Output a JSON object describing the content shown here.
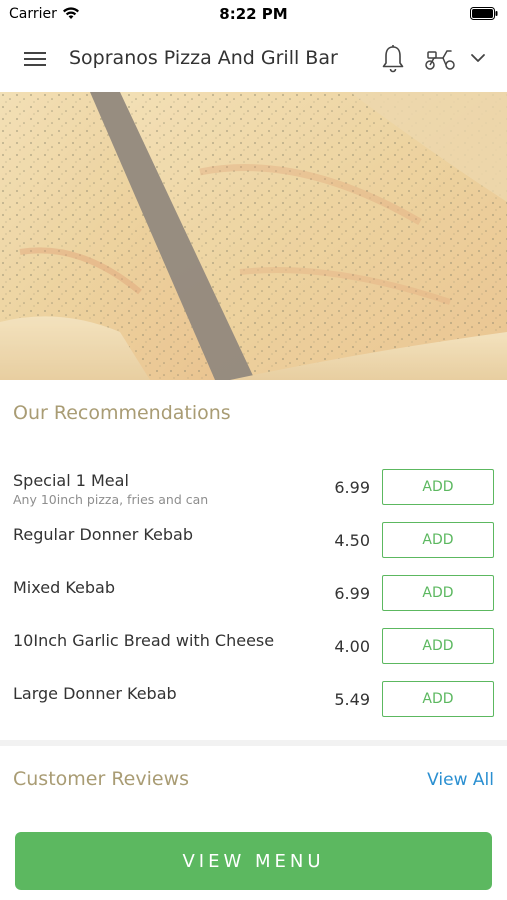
{
  "status_bar": {
    "carrier": "Carrier",
    "time": "8:22 PM"
  },
  "nav": {
    "title": "Sopranos Pizza And Grill Bar",
    "icons": [
      "menu-icon",
      "bell-icon",
      "scooter-icon",
      "chevron-down-icon"
    ]
  },
  "hero": {
    "image": "pizza-slices-photo"
  },
  "recommendations": {
    "title": "Our Recommendations",
    "add_label": "ADD",
    "items": [
      {
        "name": "Special 1 Meal",
        "description": "Any 10inch pizza, fries and can",
        "price": "6.99"
      },
      {
        "name": "Regular Donner Kebab",
        "description": "",
        "price": "4.50"
      },
      {
        "name": "Mixed Kebab",
        "description": "",
        "price": "6.99"
      },
      {
        "name": "10Inch Garlic Bread with Cheese",
        "description": "",
        "price": "4.00"
      },
      {
        "name": "Large Donner Kebab",
        "description": "",
        "price": "5.49"
      }
    ]
  },
  "reviews": {
    "title": "Customer Reviews",
    "view_all": "View All"
  },
  "footer": {
    "view_menu": "VIEW MENU"
  },
  "colors": {
    "accent_green": "#5cb860",
    "section_title": "#a99c74",
    "link_blue": "#2a8fd1"
  }
}
